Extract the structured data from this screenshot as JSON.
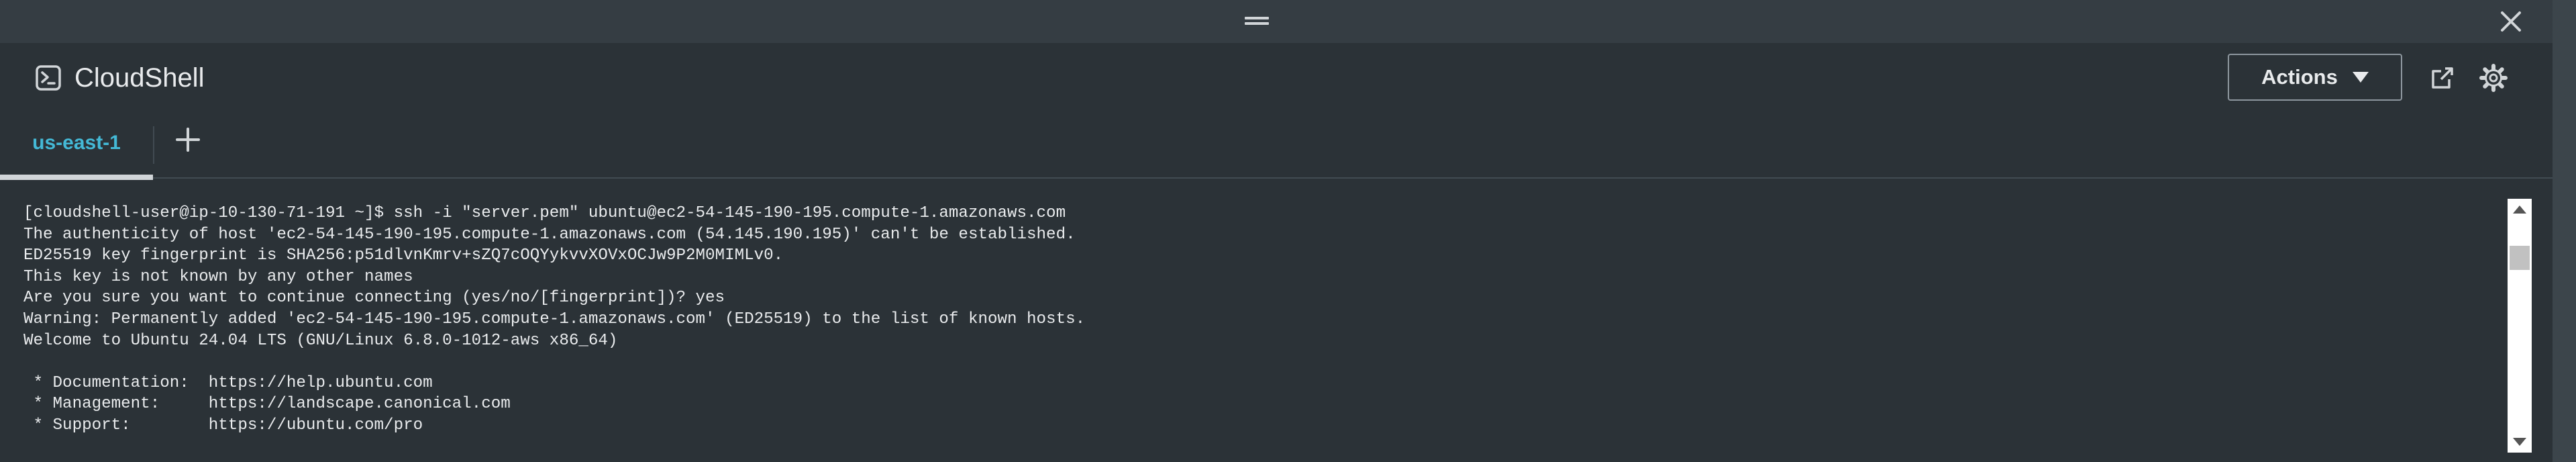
{
  "window": {
    "title": "CloudShell"
  },
  "header": {
    "actions_label": "Actions"
  },
  "tabs": [
    {
      "label": "us-east-1",
      "active": true
    }
  ],
  "terminal": {
    "lines": [
      "[cloudshell-user@ip-10-130-71-191 ~]$ ssh -i \"server.pem\" ubuntu@ec2-54-145-190-195.compute-1.amazonaws.com",
      "The authenticity of host 'ec2-54-145-190-195.compute-1.amazonaws.com (54.145.190.195)' can't be established.",
      "ED25519 key fingerprint is SHA256:p51dlvnKmrv+sZQ7cOQYykvvXOVxOCJw9P2M0MIMLv0.",
      "This key is not known by any other names",
      "Are you sure you want to continue connecting (yes/no/[fingerprint])? yes",
      "Warning: Permanently added 'ec2-54-145-190-195.compute-1.amazonaws.com' (ED25519) to the list of known hosts.",
      "Welcome to Ubuntu 24.04 LTS (GNU/Linux 6.8.0-1012-aws x86_64)",
      "",
      " * Documentation:  https://help.ubuntu.com",
      " * Management:     https://landscape.canonical.com",
      " * Support:        https://ubuntu.com/pro"
    ]
  },
  "icons": {
    "drag": "drag-handle-icon",
    "close": "close-icon",
    "shell": "terminal-icon",
    "caret": "caret-down-icon",
    "external": "external-link-icon",
    "settings": "gear-icon",
    "add": "plus-icon"
  },
  "colors": {
    "background": "#2b3237",
    "active_tab": "#44b9d6",
    "text": "#e9ebed"
  }
}
